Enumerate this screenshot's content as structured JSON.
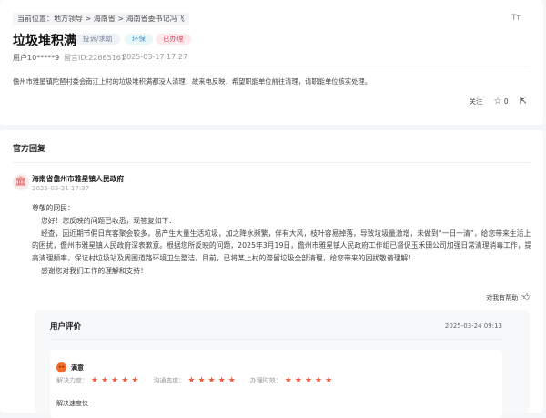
{
  "breadcrumb": "当前位置：地方领导 > 海南省 > 海南省委书记冯飞",
  "font_toggle": "Tт",
  "title": "垃圾堆积满",
  "tags": [
    "投诉/求助",
    "环保",
    "已办理"
  ],
  "user": "用户10*****9",
  "msg_id": "留言ID:22665161",
  "date": "2025-03-17 17:27",
  "description": "儋州市雅星镇陀琶村委会南江上村的垃圾堆积满都没人清理，故来电反映，希望职能单位前往清理，请职能单位核实处理。",
  "actions": {
    "follow": "关注",
    "likes": "0"
  },
  "reply": {
    "section": "官方回复",
    "org": "海南省儋州市雅星镇人民政府",
    "date": "2025-03-21 17:37",
    "greeting": "尊敬的网民：",
    "p1": "您好！您反映的问题已收悉，现答复如下：",
    "p2": "经查，因近期节假日宾客聚会较多，易产生大量生活垃圾，加之降水频繁，伴有大风，枝叶容易掉落，导致垃圾量激增，未做到“一日一清”，给您带来生活上的困扰，儋州市雅星镇人民政府深表歉意。根据您所反映的问题，2025年3月19日，儋州市雅星镇人民政府工作组已督促玉禾田公司加强日常清理消毒工作，提高清理频率，保证村垃圾站及周围道路环境卫生整洁。目前，已将某上村的滞留垃圾全部清理，给您带来的困扰敬请理解！",
    "p3": "感谢您对我们工作的理解和支持！",
    "helpful": "对我有帮助"
  },
  "evaluation": {
    "title": "用户评价",
    "date": "2025-03-24 09:13",
    "satisfaction": "满意",
    "ratings": [
      {
        "label": "解决力度：",
        "stars": 5
      },
      {
        "label": "沟通态度：",
        "stars": 5
      },
      {
        "label": "办理时效：",
        "stars": 5
      }
    ],
    "comment": "解决速度快"
  }
}
